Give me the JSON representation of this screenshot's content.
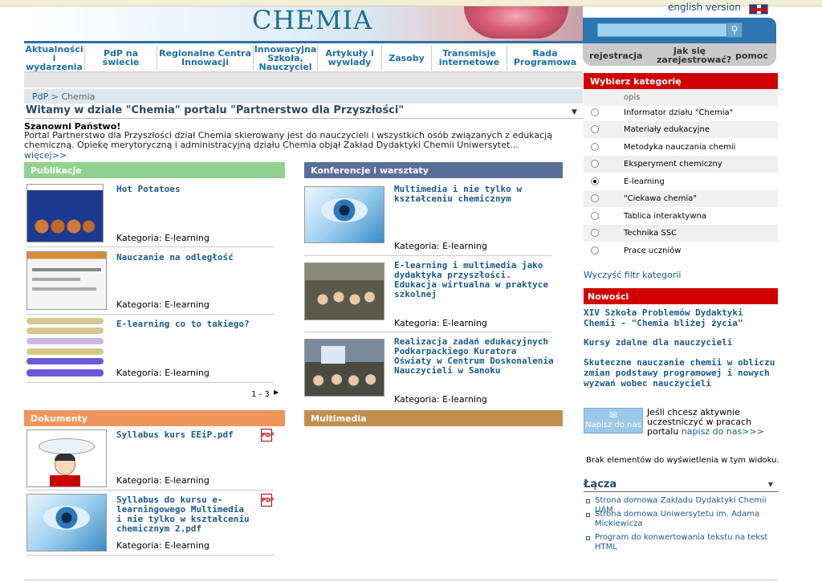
{
  "header": {
    "banner_title": "CHEMIA",
    "english_version": "english version",
    "search_button_icon": "search-icon",
    "links": [
      "rejestracja",
      "jak się zarejestrować?",
      "pomoc"
    ]
  },
  "nav": [
    "Aktualności i wydarzenia",
    "PdP na świecie",
    "Regionalne Centra Innowacji",
    "Innowacyjna Szkoła, Nauczyciel",
    "Artykuły i wywiady",
    "Zasoby",
    "Transmisje internetowe",
    "Rada Programowa"
  ],
  "breadcrumb": {
    "home": "PdP",
    "sep": " > ",
    "current": "Chemia"
  },
  "welcome_title": "Witamy w dziale \"Chemia\" portalu \"Partnerstwo dla Przyszłości\"",
  "intro": {
    "greeting": "Szanowni Państwo!",
    "text": "Portal Partnerstwo dla Przyszłości dział Chemia skierowany jest do nauczycieli i wszystkich osób związanych z edukacją chemiczną. Opiekę merytoryczną i administracyjną działu Chemia objął Zakład Dydaktyki Chemii Uniwersytet...",
    "more": "więcej>>"
  },
  "publikacje": {
    "title": "Publikacje",
    "items": [
      {
        "title": "Hot Potatoes",
        "category": "Kategoria: E-learning"
      },
      {
        "title": "Nauczanie na odległość",
        "category": "Kategoria: E-learning"
      },
      {
        "title": "E-learning co to takiego?",
        "category": "Kategoria: E-learning"
      }
    ],
    "pager": "1 - 3"
  },
  "konferencje": {
    "title": "Konferencje i warsztaty",
    "items": [
      {
        "title": "Multimedia i nie tylko w kształceniu chemicznym",
        "category": "Kategoria: E-learning"
      },
      {
        "title": "E-learning i multimedia jako dydaktyka przyszłości. Edukacja wirtualna w praktyce szkolnej",
        "category": "Kategoria: E-learning"
      },
      {
        "title": "Realizacja zadań edukacyjnych Podkarpackiego Kuratora Oświaty w Centrum Doskonalenia Nauczycieli w Sanoku",
        "category": "Kategoria: E-learning"
      }
    ]
  },
  "dokumenty": {
    "title": "Dokumenty",
    "items": [
      {
        "title": "Syllabus kurs EEiP.pdf",
        "category": "Kategoria: E-learning"
      },
      {
        "title": "Syllabus do kursu e-learningowego Multimedia i nie tylko w kształceniu chemicznym 2.pdf",
        "category": "Kategoria: E-learning"
      }
    ]
  },
  "multimedia": {
    "title": "Multimedia"
  },
  "categories": {
    "title": "Wybierz kategorię",
    "header_label": "opis",
    "items": [
      "Informator działu \"Chemia\"",
      "Materiały edukacyjne",
      "Metodyka nauczania chemii",
      "Eksperyment chemiczny",
      "E-learning",
      "\"Ciekawa chemia\"",
      "Tablica interaktywna",
      "Technika SSC",
      "Prace uczniów"
    ],
    "selected": "E-learning",
    "clear": "Wyczyść filtr kategorii"
  },
  "news": {
    "title": "Nowości",
    "items": [
      "XIV Szkoła Problemów Dydaktyki Chemii - \"Chemia bliżej życia\"",
      "Kursy zdalne dla nauczycieli",
      "Skuteczne nauczanie chemii w obliczu zmian podstawy programowej i nowych wyzwań wobec nauczycieli"
    ]
  },
  "contact": {
    "button": "Napisz do nas",
    "text": "Jeśli chcesz aktywnie uczestniczyć w pracach portalu",
    "link": "napisz do nas>>>"
  },
  "empty_msg": "Brak elementów do wyświetlenia w tym widoku.",
  "links": {
    "title": "Łącza",
    "items": [
      "Strona domowa Zakładu Dydaktyki Chemii UAM",
      "Strona domowa Uniwersytetu im. Adama Mickiewicza",
      "Program do konwertowania tekstu na tekst HTML"
    ]
  },
  "colors": {
    "publikacje": "#8fd38f",
    "konferencje": "#5a6e9a",
    "dokumenty": "#f0965a",
    "multimedia": "#c28e4e",
    "red": "#d00000"
  }
}
